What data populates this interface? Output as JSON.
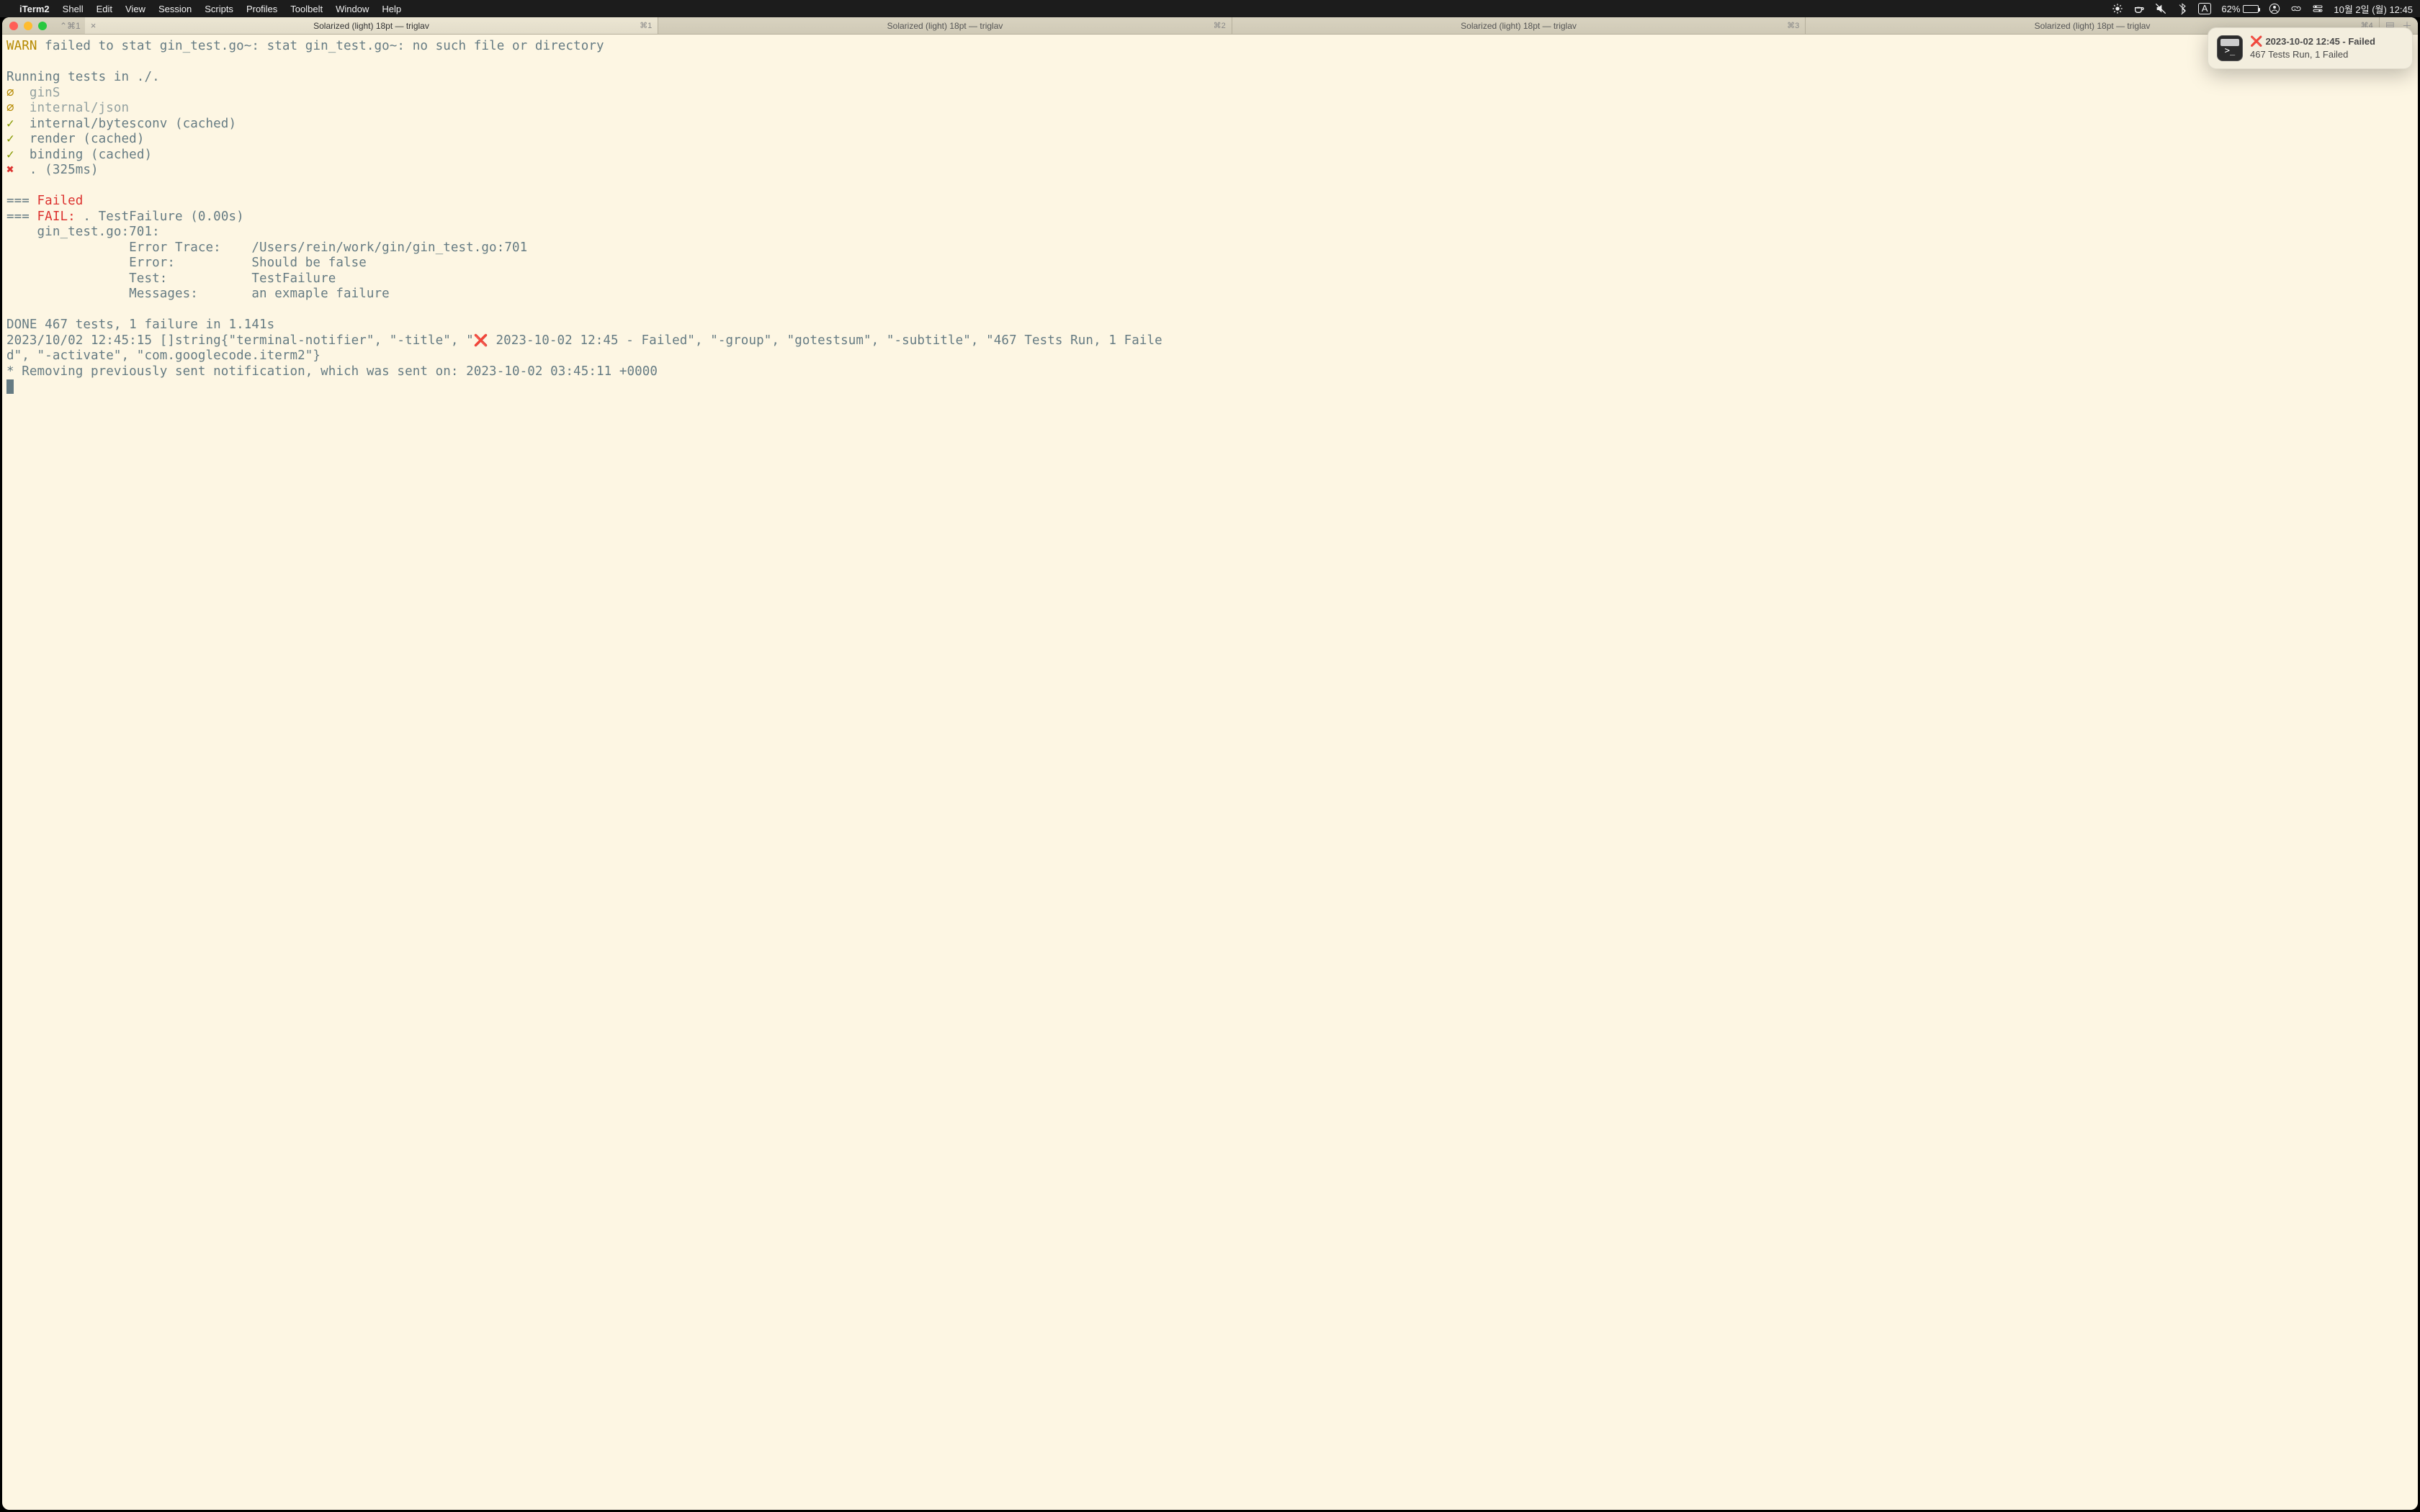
{
  "menubar": {
    "apple": "",
    "app": "iTerm2",
    "items": [
      "Shell",
      "Edit",
      "View",
      "Session",
      "Scripts",
      "Profiles",
      "Toolbelt",
      "Window",
      "Help"
    ],
    "battery_text": "62%",
    "clock": "10월 2일 (월) 12:45",
    "input_mode": "A"
  },
  "tabs": {
    "left_icons": "⌃⌘1",
    "items": [
      {
        "title": "Solarized (light) 18pt — triglav",
        "shortcut": "⌘1",
        "active": true
      },
      {
        "title": "Solarized (light) 18pt — triglav",
        "shortcut": "⌘2",
        "active": false
      },
      {
        "title": "Solarized (light) 18pt — triglav",
        "shortcut": "⌘3",
        "active": false
      },
      {
        "title": "Solarized (light) 18pt — triglav",
        "shortcut": "⌘4",
        "active": false
      }
    ]
  },
  "terminal": {
    "lines": {
      "l0_warn": "WARN",
      "l0_rest": " failed to stat gin_test.go~: stat gin_test.go~: no such file or directory",
      "l2": "Running tests in ./.",
      "l3_sym": "∅",
      "l3_txt": "  ginS",
      "l4_sym": "∅",
      "l4_txt": "  internal/json",
      "l5_sym": "✓",
      "l5_txt": "  internal/bytesconv (cached)",
      "l6_sym": "✓",
      "l6_txt": "  render (cached)",
      "l7_sym": "✓",
      "l7_txt": "  binding (cached)",
      "l8_sym": "✖",
      "l8_txt": "  . (325ms)",
      "l10_pre": "=== ",
      "l10_fail": "Failed",
      "l11_pre": "=== ",
      "l11_fail": "FAIL:",
      "l11_rest": " . TestFailure (0.00s)",
      "l12": "    gin_test.go:701:",
      "l13": "                Error Trace:    /Users/rein/work/gin/gin_test.go:701",
      "l14": "                Error:          Should be false",
      "l15": "                Test:           TestFailure",
      "l16": "                Messages:       an exmaple failure",
      "l18": "DONE 467 tests, 1 failure in 1.141s",
      "l19a": "2023/10/02 12:45:15 []string{\"terminal-notifier\", \"-title\", \"",
      "l19b": "❌",
      "l19c": " 2023-10-02 12:45 - Failed\", \"-group\", \"gotestsum\", \"-subtitle\", \"467 Tests Run, 1 Faile",
      "l20": "d\", \"-activate\", \"com.googlecode.iterm2\"}",
      "l21": "* Removing previously sent notification, which was sent on: 2023-10-02 03:45:11 +0000"
    }
  },
  "notification": {
    "emoji": "❌",
    "title": "2023-10-02 12:45 - Failed",
    "subtitle": "467 Tests Run, 1 Failed",
    "icon_text": ">_"
  }
}
